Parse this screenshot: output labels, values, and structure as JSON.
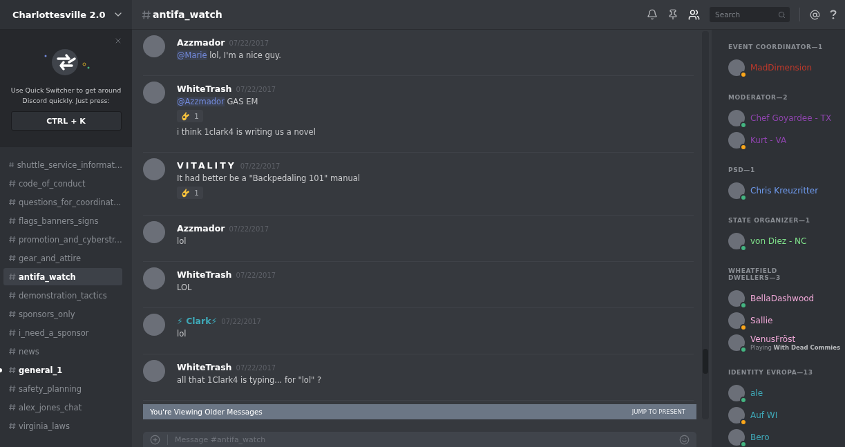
{
  "server": {
    "name": "Charlottesville 2.0"
  },
  "quick_switcher": {
    "text": "Use Quick Switcher to get around Discord quickly. Just press:",
    "shortcut": "CTRL + K"
  },
  "channels": [
    {
      "name": "shuttle_service_informat...",
      "selected": false,
      "unread": false
    },
    {
      "name": "code_of_conduct",
      "selected": false,
      "unread": false
    },
    {
      "name": "questions_for_coordinat...",
      "selected": false,
      "unread": false
    },
    {
      "name": "flags_banners_signs",
      "selected": false,
      "unread": false
    },
    {
      "name": "promotion_and_cyberstr...",
      "selected": false,
      "unread": false
    },
    {
      "name": "gear_and_attire",
      "selected": false,
      "unread": false
    },
    {
      "name": "antifa_watch",
      "selected": true,
      "unread": false
    },
    {
      "name": "demonstration_tactics",
      "selected": false,
      "unread": false
    },
    {
      "name": "sponsors_only",
      "selected": false,
      "unread": false
    },
    {
      "name": "i_need_a_sponsor",
      "selected": false,
      "unread": false
    },
    {
      "name": "news",
      "selected": false,
      "unread": false
    },
    {
      "name": "general_1",
      "selected": false,
      "unread": true
    },
    {
      "name": "safety_planning",
      "selected": false,
      "unread": false
    },
    {
      "name": "alex_jones_chat",
      "selected": false,
      "unread": false
    },
    {
      "name": "virginia_laws",
      "selected": false,
      "unread": false
    }
  ],
  "header": {
    "channel": "antifa_watch",
    "search_placeholder": "Search"
  },
  "messages": [
    {
      "author": "Azzmador",
      "color": "#ffffff",
      "spaced": false,
      "time": "07/22/2017",
      "lines": [
        {
          "kind": "text",
          "mention": "@Marie",
          "text": "lol, I'm a nice guy."
        }
      ]
    },
    {
      "author": "WhiteTrash",
      "color": "#ffffff",
      "spaced": false,
      "time": "07/22/2017",
      "lines": [
        {
          "kind": "text",
          "mention": "@Azzmador",
          "text": "GAS EM"
        },
        {
          "kind": "reaction",
          "count": "1"
        },
        {
          "kind": "text",
          "text": "i think 1clark4 is writing us a novel"
        }
      ]
    },
    {
      "author": "VITALITY",
      "color": "#ffffff",
      "spaced": true,
      "time": "07/22/2017",
      "lines": [
        {
          "kind": "text",
          "text": "It had better be a \"Backpedaling 101\" manual"
        },
        {
          "kind": "reaction",
          "count": "1"
        }
      ]
    },
    {
      "author": "Azzmador",
      "color": "#ffffff",
      "spaced": false,
      "time": "07/22/2017",
      "lines": [
        {
          "kind": "text",
          "text": "lol"
        }
      ]
    },
    {
      "author": "WhiteTrash",
      "color": "#ffffff",
      "spaced": false,
      "time": "07/22/2017",
      "lines": [
        {
          "kind": "text",
          "text": "LOL"
        }
      ]
    },
    {
      "author": "⚡ Clark⚡",
      "color": "#3fa9b8",
      "spaced": false,
      "time": "07/22/2017",
      "lines": [
        {
          "kind": "text",
          "text": "lol"
        }
      ]
    },
    {
      "author": "WhiteTrash",
      "color": "#ffffff",
      "spaced": false,
      "time": "07/22/2017",
      "lines": [
        {
          "kind": "text",
          "text": "all that 1Clark4 is typing... for \"lol\" ?"
        }
      ]
    }
  ],
  "banner": {
    "text": "You're Viewing Older Messages",
    "action": "JUMP TO PRESENT"
  },
  "composer": {
    "placeholder": "Message #antifa_watch"
  },
  "member_groups": [
    {
      "title": "EVENT COORDINATOR—1",
      "color": "#c0392b",
      "members": [
        {
          "name": "MadDimension",
          "color": "#faa61a"
        }
      ]
    },
    {
      "title": "MODERATOR—2",
      "color": "#8e44ad",
      "members": [
        {
          "name": "Chef Goyardee - TX",
          "color": "#43b581"
        },
        {
          "name": "Kurt - VA",
          "color": "#faa61a"
        }
      ]
    },
    {
      "title": "PSD—1",
      "color": "#6f9bef",
      "members": [
        {
          "name": "Chris Kreuzritter",
          "color": "#43b581"
        }
      ]
    },
    {
      "title": "STATE ORGANIZER—1",
      "color": "#7fe08a",
      "members": [
        {
          "name": "von Diez - NC",
          "color": "#43b581"
        }
      ]
    },
    {
      "title": "WHEATFIELD DWELLERS—3",
      "color": "#f0a8d8",
      "members": [
        {
          "name": "BellaDashwood",
          "color": "#43b581"
        },
        {
          "name": "Sallie",
          "color": "#faa61a"
        },
        {
          "name": "VenusFröst",
          "color": "#43b581",
          "activity": "Playing **With Dead Commies**"
        }
      ]
    },
    {
      "title": "IDENTITY EVROPA—13",
      "color": "#3fa9b8",
      "members": [
        {
          "name": "ale",
          "color": "#43b581"
        },
        {
          "name": "Auf WI",
          "color": "#faa61a"
        },
        {
          "name": "Bero",
          "color": "#43b581"
        }
      ]
    }
  ]
}
